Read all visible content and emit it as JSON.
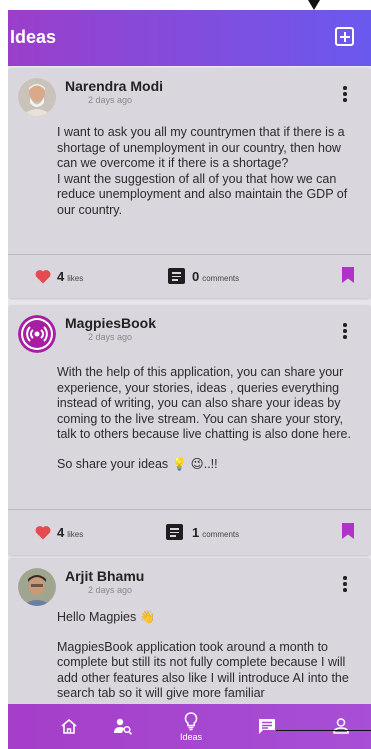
{
  "appbar": {
    "title": "Ideas",
    "add_icon": "add-box-icon"
  },
  "posts": [
    {
      "author": "Narendra Modi",
      "time": "2 days ago",
      "paragraphs": [
        "I want to ask you all my countrymen that if there is a shortage of unemployment in our country, then how can we overcome it if there is a shortage?\nI want the suggestion of all of you that how we can reduce unemployment and also maintain the GDP of our country."
      ],
      "likes_count": "4",
      "likes_label": "likes",
      "comments_count": "0",
      "comments_label": "comments"
    },
    {
      "author": "MagpiesBook",
      "time": "2 days ago",
      "paragraphs": [
        "With the help of this application, you can share your experience, your stories, ideas , queries everything instead of writing, you can also share your ideas by coming to the live stream.  You can share your story, talk to others because live chatting is also done here.",
        "So share your ideas 💡 😉..!!"
      ],
      "likes_count": "4",
      "likes_label": "likes",
      "comments_count": "1",
      "comments_label": "comments"
    },
    {
      "author": "Arjit Bhamu",
      "time": "2 days ago",
      "paragraphs": [
        "Hello Magpies 👋",
        "MagpiesBook application took around a month to complete but still its not fully complete because I will add other features also like I will introduce AI into the search tab so it will give more familiar"
      ]
    }
  ],
  "nav": {
    "items": [
      {
        "icon": "home-icon",
        "label": ""
      },
      {
        "icon": "search-user-icon",
        "label": ""
      },
      {
        "icon": "lightbulb-icon",
        "label": "Ideas"
      },
      {
        "icon": "chat-icon",
        "label": ""
      },
      {
        "icon": "profile-icon",
        "label": ""
      }
    ],
    "active_index": 2
  },
  "colors": {
    "appbar_start": "#9a3fcb",
    "appbar_end": "#6a59ee",
    "accent": "#b032c8",
    "heart": "#e34b50",
    "card_bg": "#d9d6dd"
  }
}
